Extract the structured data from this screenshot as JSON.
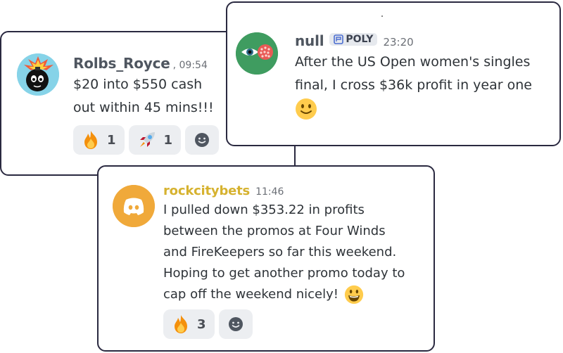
{
  "messages": [
    {
      "username": "Rolbs_Royce",
      "timestamp": ", 09:54",
      "lines": [
        "$20 into $550 cash",
        "out within 45  mins!!!"
      ],
      "reactions": [
        {
          "emoji": "fire-icon",
          "count": "1"
        },
        {
          "emoji": "rocket-icon",
          "count": "1"
        }
      ],
      "avatar": "bomb-avatar",
      "name_color": "#4f5660"
    },
    {
      "username": "null",
      "badge": "POLY",
      "timestamp": "23:20",
      "lines": [
        "After the US Open women's singles",
        "final, I cross $36k profit in year one"
      ],
      "trailing_emoji": "slightly-smiling-face-icon",
      "avatar": "eye-avatar",
      "name_color": "#4f5660"
    },
    {
      "username": "rockcitybets",
      "timestamp": "11:46",
      "lines": [
        "I pulled down $353.22 in profits",
        "between the promos at Four Winds",
        "and FireKeepers so far this weekend.",
        "Hoping to get another promo today to",
        "cap off the weekend nicely!"
      ],
      "trailing_emoji": "grinning-face-icon",
      "reactions": [
        {
          "emoji": "fire-icon",
          "count": "3"
        }
      ],
      "avatar": "discord-avatar",
      "name_color": "#d6b22f"
    }
  ]
}
